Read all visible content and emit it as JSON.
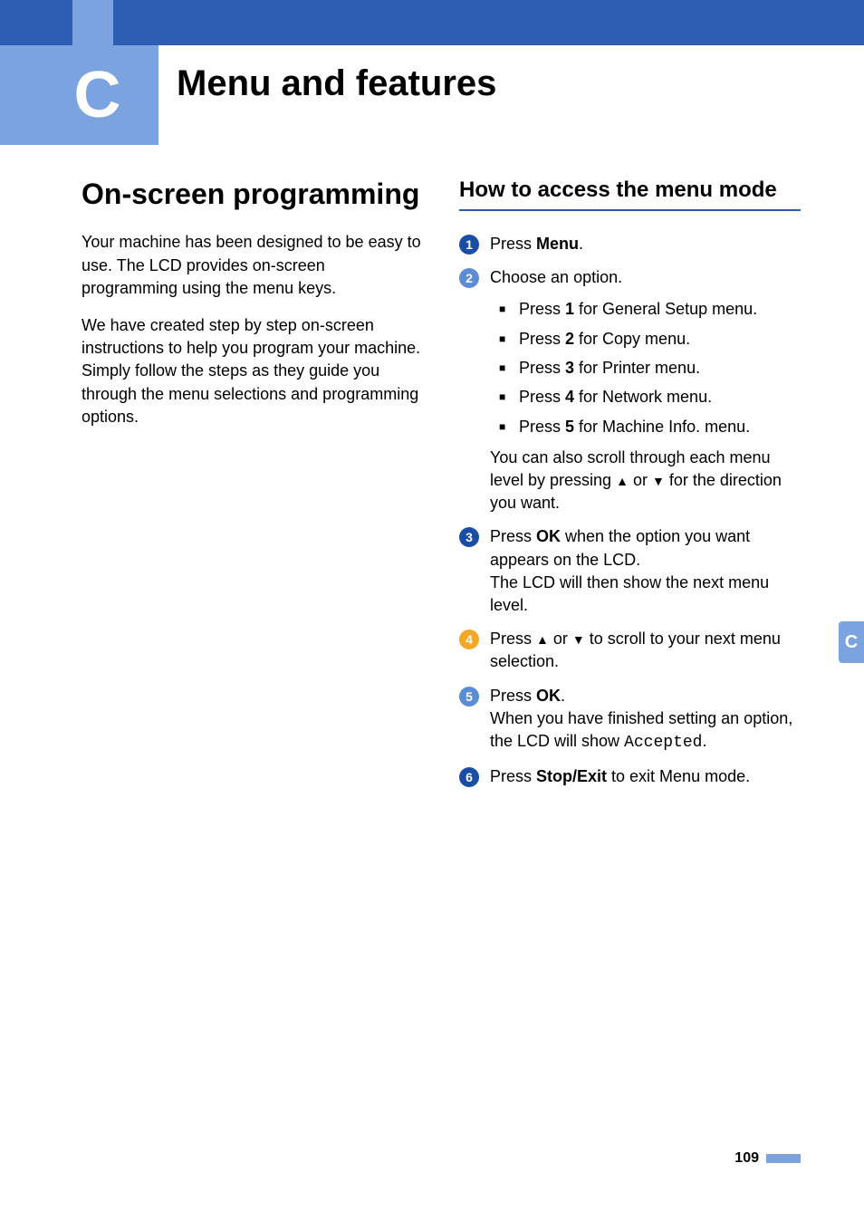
{
  "chapter": {
    "letter": "C",
    "title": "Menu and features"
  },
  "left": {
    "heading": "On-screen programming",
    "para1": "Your machine has been designed to be easy to use. The LCD provides on-screen programming using the menu keys.",
    "para2": "We have created step by step on-screen instructions to help you program your machine. Simply follow the steps as they guide you through the menu selections and programming options."
  },
  "right": {
    "heading": "How to access the menu mode",
    "steps": {
      "s1": {
        "pre": "Press ",
        "bold": "Menu",
        "post": "."
      },
      "s2": {
        "intro": "Choose an option.",
        "items": [
          {
            "pre": "Press ",
            "bold": "1",
            "post": " for General Setup menu."
          },
          {
            "pre": "Press ",
            "bold": "2",
            "post": " for Copy menu."
          },
          {
            "pre": "Press ",
            "bold": "3",
            "post": " for Printer menu."
          },
          {
            "pre": "Press ",
            "bold": "4",
            "post": " for Network menu."
          },
          {
            "pre": "Press ",
            "bold": "5",
            "post": " for Machine Info. menu."
          }
        ],
        "outro_pre": "You can also scroll through each menu level by pressing ",
        "outro_up": "▲",
        "outro_mid": " or ",
        "outro_down": "▼",
        "outro_post": " for the direction you want."
      },
      "s3": {
        "pre": "Press ",
        "bold": "OK",
        "post": " when the option you want appears on the LCD.",
        "line2": "The LCD will then show the next menu level."
      },
      "s4": {
        "pre": "Press ",
        "up": "▲",
        "mid": " or ",
        "down": "▼",
        "post": " to scroll to your next menu selection."
      },
      "s5": {
        "pre": "Press ",
        "bold": "OK",
        "post": ".",
        "line2_pre": "When you have finished setting an option, the LCD will show ",
        "mono": "Accepted",
        "line2_post": "."
      },
      "s6": {
        "pre": "Press ",
        "bold": "Stop/Exit",
        "post": " to exit Menu mode."
      }
    }
  },
  "sidetab": "C",
  "page": "109",
  "nums": {
    "n1": "1",
    "n2": "2",
    "n3": "3",
    "n4": "4",
    "n5": "5",
    "n6": "6"
  }
}
